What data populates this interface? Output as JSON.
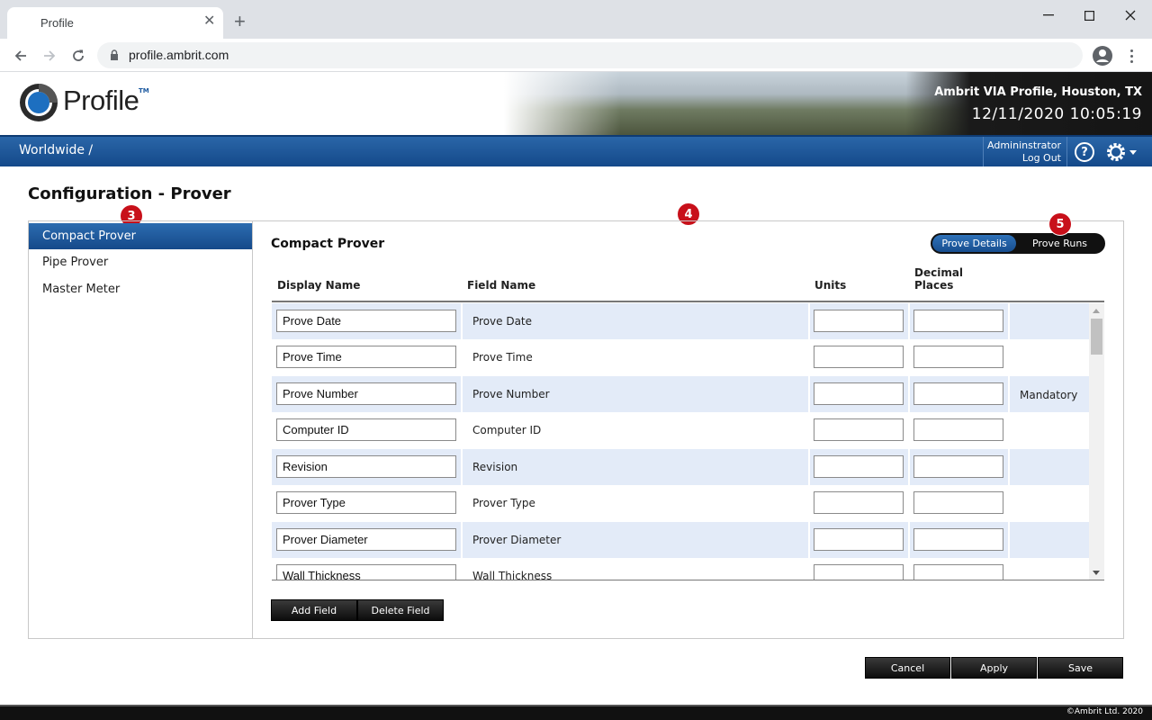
{
  "browser": {
    "tab_title": "Profile",
    "url": "profile.ambrit.com"
  },
  "header": {
    "logo_text": "Profile",
    "logo_tm": "TM",
    "site_name": "Ambrit VIA Profile, Houston, TX",
    "datetime": "12/11/2020 10:05:19"
  },
  "nav": {
    "breadcrumb": "Worldwide /",
    "user": "Admininstrator",
    "logout": "Log Out",
    "help": "?"
  },
  "page": {
    "title": "Configuration - Prover"
  },
  "badges": [
    "3",
    "4",
    "5"
  ],
  "sidebar": {
    "items": [
      {
        "label": "Compact Prover",
        "active": true
      },
      {
        "label": "Pipe Prover",
        "active": false
      },
      {
        "label": "Master Meter",
        "active": false
      }
    ]
  },
  "panel": {
    "title": "Compact Prover",
    "toggle": {
      "details": "Prove Details",
      "runs": "Prove Runs",
      "selected": "Prove Details"
    },
    "columns": {
      "display_name": "Display Name",
      "field_name": "Field Name",
      "units": "Units",
      "decimal_line1": "Decimal",
      "decimal_line2": "Places"
    },
    "rows": [
      {
        "display": "Prove Date",
        "field": "Prove Date",
        "units": "",
        "decimals": "",
        "note": ""
      },
      {
        "display": "Prove Time",
        "field": "Prove Time",
        "units": "",
        "decimals": "",
        "note": ""
      },
      {
        "display": "Prove Number",
        "field": "Prove Number",
        "units": "",
        "decimals": "",
        "note": "Mandatory"
      },
      {
        "display": "Computer ID",
        "field": "Computer ID",
        "units": "",
        "decimals": "",
        "note": ""
      },
      {
        "display": "Revision",
        "field": "Revision",
        "units": "",
        "decimals": "",
        "note": ""
      },
      {
        "display": "Prover Type",
        "field": "Prover Type",
        "units": "",
        "decimals": "",
        "note": ""
      },
      {
        "display": "Prover Diameter",
        "field": "Prover Diameter",
        "units": "",
        "decimals": "",
        "note": ""
      },
      {
        "display": "Wall Thickness",
        "field": "Wall Thickness",
        "units": "",
        "decimals": "",
        "note": ""
      }
    ],
    "add_field": "Add Field",
    "delete_field": "Delete Field"
  },
  "actions": {
    "cancel": "Cancel",
    "apply": "Apply",
    "save": "Save"
  },
  "footer": {
    "copyright": "©Ambrit Ltd. 2020"
  },
  "colors": {
    "brand_blue": "#14498a",
    "row_alt": "#e3ebf8",
    "badge_red": "#c8101a"
  }
}
